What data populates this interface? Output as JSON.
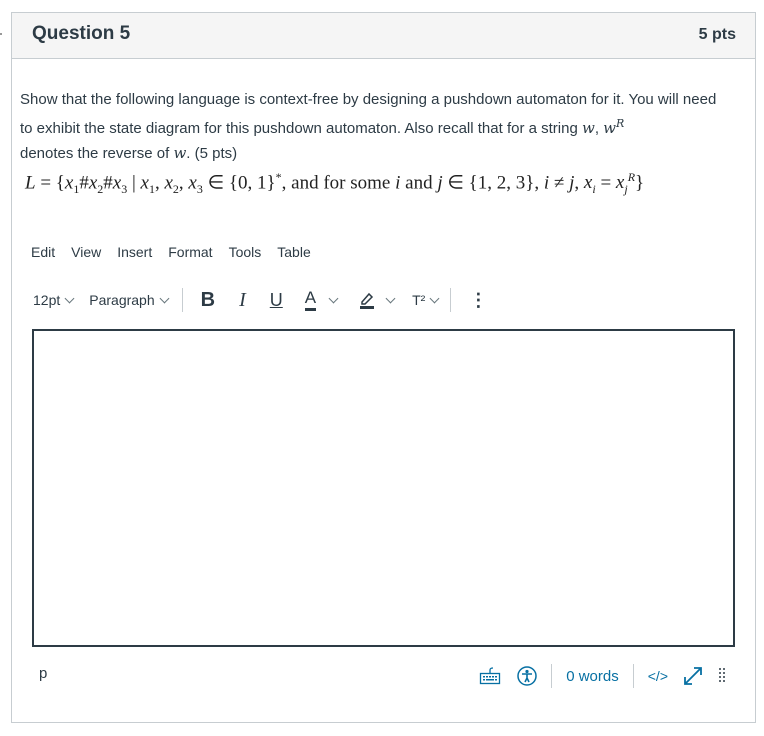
{
  "question": {
    "title": "Question 5",
    "points": "5 pts",
    "prompt_part1": "Show that the following language is context-free by designing a pushdown automaton for it. You will need to exhibit the state diagram for this pushdown automaton. Also recall that for a string ",
    "prompt_var_w": "w",
    "prompt_comma": ", ",
    "prompt_wR": "w",
    "prompt_R": "R",
    "prompt_part2": " denotes the reverse of ",
    "prompt_var_w2": "w",
    "prompt_part3": ". (5 pts)",
    "formula": {
      "lhs": "L = {",
      "body": "x₁#x₂#x₃ | x₁, x₂, x₃ ∈ {0,1}*, and for some i and j ∈ {1,2,3}, i ≠ j, xᵢ = xⱼᴿ}"
    }
  },
  "editor": {
    "menu": [
      "Edit",
      "View",
      "Insert",
      "Format",
      "Tools",
      "Table"
    ],
    "font_size": "12pt",
    "block_format": "Paragraph",
    "bold": "B",
    "italic": "I",
    "underline": "U",
    "text_color": "A",
    "superscript": "T²",
    "more": "⋮",
    "content": "",
    "path": "p",
    "word_count": "0 words",
    "html_toggle": "</>",
    "accent_color": "#0770a3"
  }
}
